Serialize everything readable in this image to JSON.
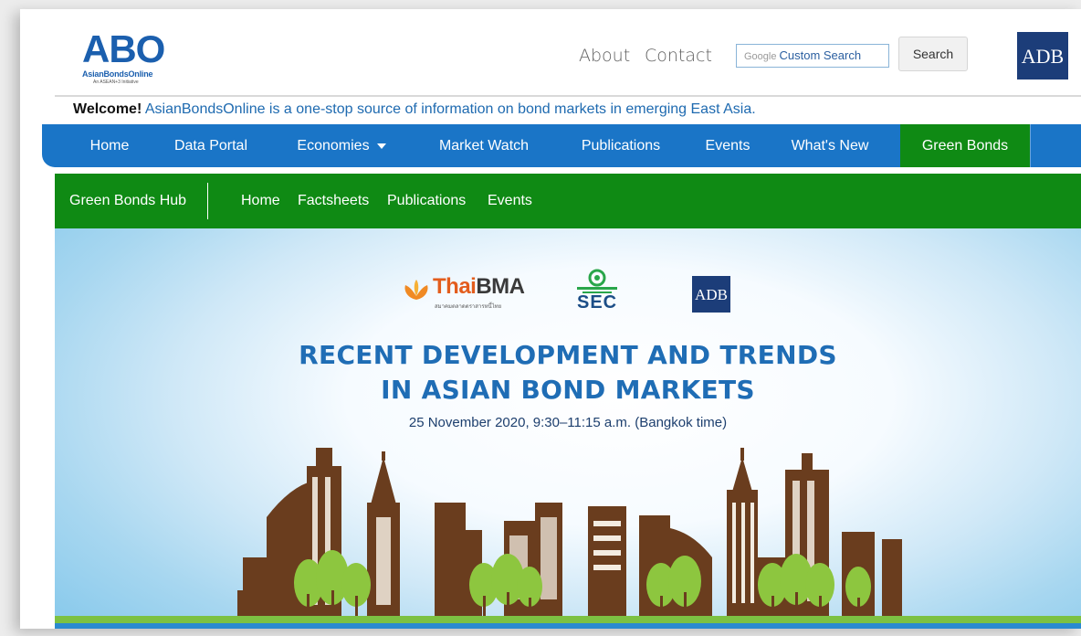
{
  "header": {
    "logo_text": "ABO",
    "logo_subtitle": "AsianBondsOnline",
    "logo_tagline": "An ASEAN+3 Initiative",
    "links": [
      "About",
      "Contact"
    ],
    "search_placeholder_brand": "Google",
    "search_placeholder": "Custom Search",
    "search_button": "Search",
    "adb_logo": "ADB"
  },
  "welcome": {
    "bold": "Welcome!",
    "text": " AsianBondsOnline is a one-stop source of information on bond markets in emerging East Asia."
  },
  "main_nav": {
    "items": [
      "Home",
      "Data Portal",
      "Economies",
      "Market Watch",
      "Publications",
      "Events",
      "What's New",
      "Green Bonds"
    ],
    "active": "Green Bonds",
    "active_color": "#0f8a14",
    "bar_color": "#1a75c7"
  },
  "sub_nav": {
    "title": "Green Bonds Hub",
    "links": [
      "Home",
      "Factsheets",
      "Publications",
      "Events"
    ]
  },
  "banner": {
    "sponsor_thai": "Thai",
    "sponsor_thai_bma": "BMA",
    "sponsor_thai_sub": "สมาคมตลาดตราสารหนี้ไทย",
    "sponsor_sec": "SEC",
    "sponsor_adb": "ADB",
    "title_line1": "RECENT DEVELOPMENT AND TRENDS",
    "title_line2": "IN ASIAN BOND MARKETS",
    "date": "25 November 2020, 9:30–11:15 a.m. (Bangkok time)"
  },
  "colors": {
    "brand_blue": "#1a75c7",
    "green": "#0f8a14",
    "headline_blue": "#1f6db5",
    "building_brown": "#6a3d1e"
  }
}
